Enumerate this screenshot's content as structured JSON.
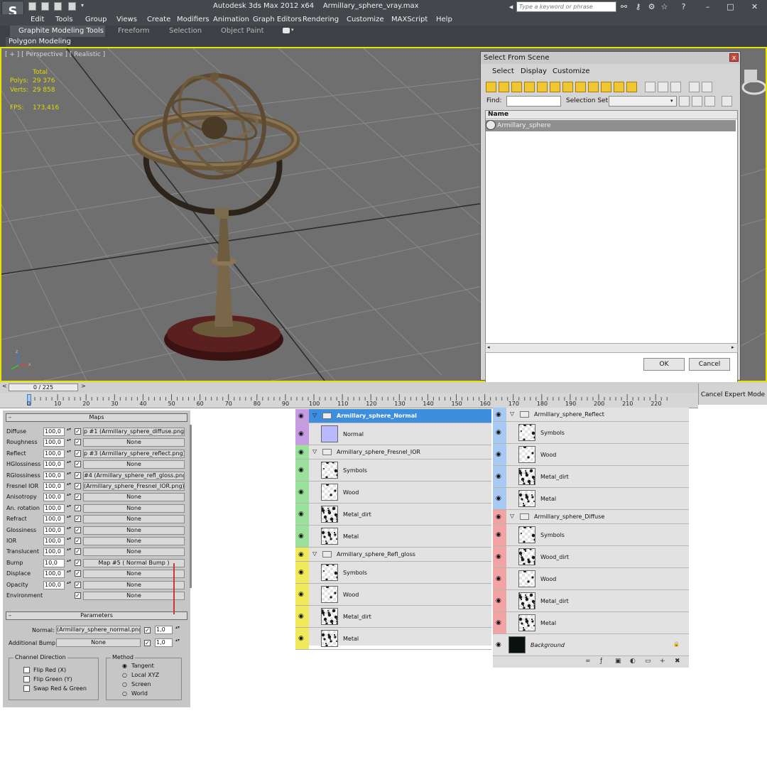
{
  "app": {
    "title": "Autodesk 3ds Max  2012 x64",
    "file": "Armillary_sphere_vray.max",
    "logo": "S",
    "search_placeholder": "Type a keyword or phrase"
  },
  "menu": [
    "Edit",
    "Tools",
    "Group",
    "Views",
    "Create",
    "Modifiers",
    "Animation",
    "Graph Editors",
    "Rendering",
    "Customize",
    "MAXScript",
    "Help"
  ],
  "ribbon": {
    "tabs": [
      "Graphite Modeling Tools",
      "Freeform",
      "Selection",
      "Object Paint"
    ],
    "sub": "Polygon Modeling"
  },
  "viewport": {
    "label": "[ + ] [ Perspective ] [ Realistic ]",
    "stats_header": "Total",
    "polys_label": "Polys:",
    "polys": "29 376",
    "verts_label": "Verts:",
    "verts": "29 858",
    "fps_label": "FPS:",
    "fps": "173,416"
  },
  "select_scene": {
    "title": "Select From Scene",
    "close": "x",
    "menu": [
      "Select",
      "Display",
      "Customize"
    ],
    "find_label": "Find:",
    "selection_set_label": "Selection Set:",
    "column": "Name",
    "items": [
      "Armillary_sphere"
    ],
    "ok": "OK",
    "cancel": "Cancel"
  },
  "timeline": {
    "frame": "0 / 225",
    "cancel_expert": "Cancel Expert Mode",
    "ticks": [
      "0",
      "10",
      "20",
      "30",
      "40",
      "50",
      "60",
      "70",
      "80",
      "90",
      "100",
      "110",
      "120",
      "130",
      "140",
      "150",
      "160",
      "170",
      "180",
      "190",
      "200",
      "210",
      "220"
    ]
  },
  "material": {
    "maps_title": "Maps",
    "maps": [
      {
        "label": "Diffuse",
        "value": "100,0",
        "map": "p #1 (Armillary_sphere_diffuse.png)"
      },
      {
        "label": "Roughness",
        "value": "100,0",
        "map": "None"
      },
      {
        "label": "Reflect",
        "value": "100,0",
        "map": "p #3 (Armillary_sphere_reflect.png)"
      },
      {
        "label": "HGlossiness",
        "value": "100,0",
        "map": "None"
      },
      {
        "label": "RGlossiness",
        "value": "100,0",
        "map": "#4 (Armillary_sphere_refl_gloss.png)"
      },
      {
        "label": "Fresnel IOR",
        "value": "100,0",
        "map": "(Armillary_sphere_Fresnel_IOR.png)"
      },
      {
        "label": "Anisotropy",
        "value": "100,0",
        "map": "None"
      },
      {
        "label": "An. rotation",
        "value": "100,0",
        "map": "None"
      },
      {
        "label": "Refract",
        "value": "100,0",
        "map": "None"
      },
      {
        "label": "Glossiness",
        "value": "100,0",
        "map": "None"
      },
      {
        "label": "IOR",
        "value": "100,0",
        "map": "None"
      },
      {
        "label": "Translucent",
        "value": "100,0",
        "map": "None"
      },
      {
        "label": "Bump",
        "value": "10,0",
        "map": "Map #5  ( Normal Bump )"
      },
      {
        "label": "Displace",
        "value": "100,0",
        "map": "None"
      },
      {
        "label": "Opacity",
        "value": "100,0",
        "map": "None"
      },
      {
        "label": "Environment",
        "value": "",
        "map": "None"
      }
    ],
    "params_title": "Parameters",
    "normal_label": "Normal:",
    "normal_map": "(Armillary_sphere_normal.png)",
    "normal_value": "1,0",
    "addbump_label": "Additional Bump:",
    "addbump_map": "None",
    "addbump_value": "1,0",
    "channel_title": "Channel Direction",
    "channel_opts": [
      "Flip Red (X)",
      "Flip Green (Y)",
      "Swap Red & Green"
    ],
    "method_title": "Method",
    "method_opts": [
      "Tangent",
      "Local XYZ",
      "Screen",
      "World"
    ],
    "method_selected": "Tangent"
  },
  "layers_left": {
    "groups": [
      {
        "name": "Armillary_sphere_Normal",
        "color": "#c79be3",
        "selected": true,
        "items": [
          "Normal"
        ]
      },
      {
        "name": "Armillary_sphere_Fresnel_IOR",
        "color": "#9be09b",
        "selected": false,
        "items": [
          "Symbols",
          "Wood",
          "Metal_dirt",
          "Metal"
        ]
      },
      {
        "name": "Armillary_sphere_Refl_gloss",
        "color": "#f0ea5a",
        "selected": false,
        "items": [
          "Symbols",
          "Wood",
          "Metal_dirt",
          "Metal"
        ]
      }
    ]
  },
  "layers_right": {
    "groups": [
      {
        "name": "Armillary_sphere_Reflect",
        "color": "#a8c9f2",
        "items": [
          "Symbols",
          "Wood",
          "Metal_dirt",
          "Metal"
        ]
      },
      {
        "name": "Armillary_sphere_Diffuse",
        "color": "#f2a3a3",
        "items": [
          "Symbols",
          "Wood_dirt",
          "Wood",
          "Metal_dirt",
          "Metal"
        ]
      }
    ],
    "background": "Background"
  },
  "colors": {
    "viewport_border": "#e8e400",
    "selected_layer": "#3e8ede"
  }
}
